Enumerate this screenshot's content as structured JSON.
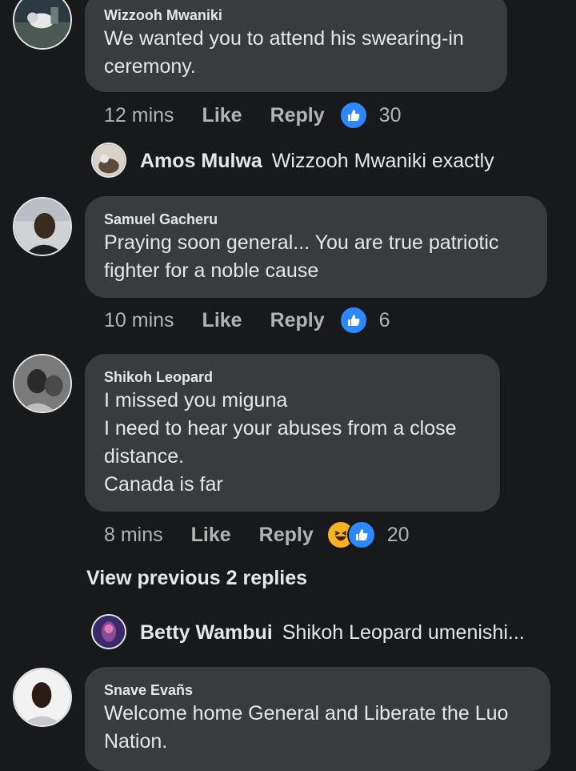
{
  "comments": [
    {
      "author": "Wizzooh Mwaniki",
      "lines": [
        "We wanted you to attend his swearing-in",
        "ceremony."
      ],
      "time": "12 mins",
      "like": "Like",
      "reply": "Reply",
      "reactions": [
        "like-icon"
      ],
      "count": "30"
    },
    {
      "author": "Samuel Gacheru",
      "lines": [
        "Praying soon general... You are true patriotic",
        "fighter for a noble cause"
      ],
      "time": "10 mins",
      "like": "Like",
      "reply": "Reply",
      "reactions": [
        "like-icon"
      ],
      "count": "6"
    },
    {
      "author": "Shikoh Leopard",
      "lines": [
        "I missed you miguna",
        "I need to hear your abuses from a close",
        "distance.",
        "Canada is far"
      ],
      "time": "8 mins",
      "like": "Like",
      "reply": "Reply",
      "reactions": [
        "haha-icon",
        "like-icon"
      ],
      "count": "20"
    },
    {
      "author": "Snave Evañs",
      "lines": [
        "Welcome home General and Liberate the Luo",
        "Nation."
      ]
    }
  ],
  "replies": [
    {
      "author": "Amos Mulwa",
      "text": "Wizzooh Mwaniki exactly"
    },
    {
      "author": "Betty Wambui",
      "text": "Shikoh Leopard umenishi..."
    }
  ],
  "view_previous": "View previous 2 replies",
  "colors": {
    "background": "#18191a",
    "bubble": "#3a3b3c",
    "text": "#e4e6eb",
    "secondary": "#b0b3b8",
    "like_blue": "#2d88ff",
    "haha_yellow": "#f7b125"
  }
}
